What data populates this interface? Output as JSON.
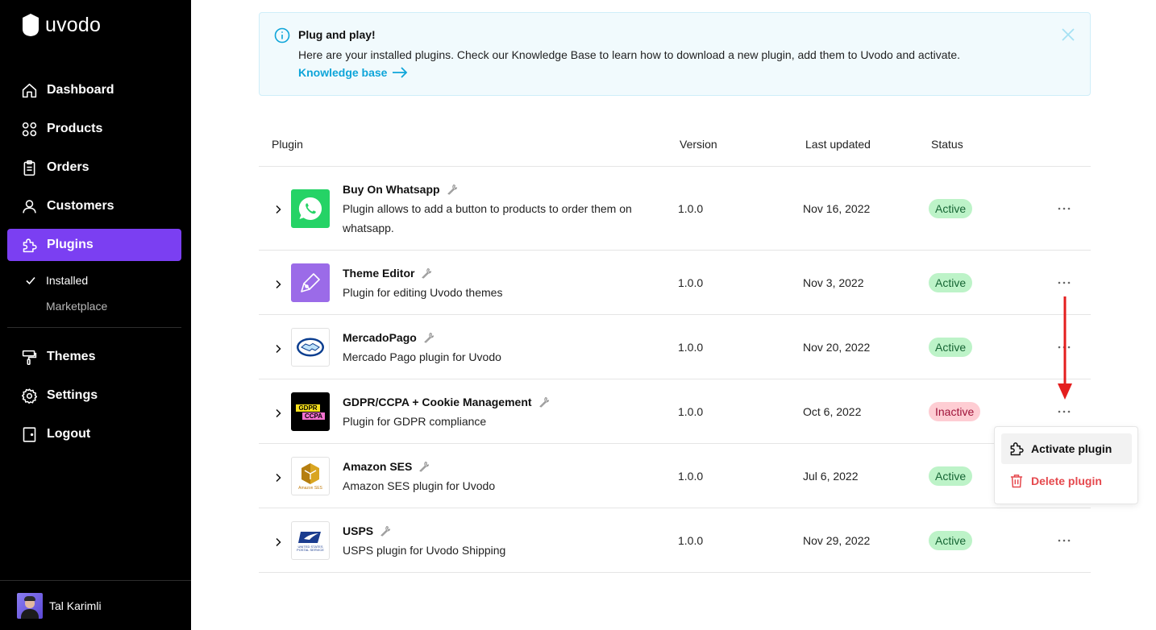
{
  "brand": {
    "name": "uvodo"
  },
  "sidebar": {
    "items": [
      {
        "label": "Dashboard",
        "icon": "home-icon"
      },
      {
        "label": "Products",
        "icon": "grid-icon"
      },
      {
        "label": "Orders",
        "icon": "clipboard-icon"
      },
      {
        "label": "Customers",
        "icon": "user-icon"
      },
      {
        "label": "Plugins",
        "icon": "puzzle-icon",
        "active": true
      }
    ],
    "subitems": [
      {
        "label": "Installed",
        "selected": true
      },
      {
        "label": "Marketplace"
      }
    ],
    "items_bottom": [
      {
        "label": "Themes",
        "icon": "paint-roller-icon"
      },
      {
        "label": "Settings",
        "icon": "gear-icon"
      },
      {
        "label": "Logout",
        "icon": "door-icon"
      }
    ],
    "user": {
      "name": "Tal Karimli"
    }
  },
  "banner": {
    "title": "Plug and play!",
    "text": "Here are your installed plugins. Check our Knowledge Base to learn how to download a new plugin, add them to Uvodo and activate.",
    "link": "Knowledge base"
  },
  "table": {
    "headers": {
      "plugin": "Plugin",
      "version": "Version",
      "updated": "Last updated",
      "status": "Status"
    },
    "rows": [
      {
        "name": "Buy On Whatsapp",
        "description": "Plugin allows to add a button to products to order them on whatsapp.",
        "version": "1.0.0",
        "updated": "Nov 16, 2022",
        "status": "Active",
        "logo": "whatsapp-logo"
      },
      {
        "name": "Theme Editor",
        "description": "Plugin for editing Uvodo themes",
        "version": "1.0.0",
        "updated": "Nov 3, 2022",
        "status": "Active",
        "logo": "theme-editor-logo"
      },
      {
        "name": "MercadoPago",
        "description": "Mercado Pago plugin for Uvodo",
        "version": "1.0.0",
        "updated": "Nov 20, 2022",
        "status": "Active",
        "logo": "mercadopago-logo"
      },
      {
        "name": "GDPR/CCPA + Cookie Management",
        "description": "Plugin for GDPR compliance",
        "version": "1.0.0",
        "updated": "Oct 6, 2022",
        "status": "Inactive",
        "logo": "gdpr-logo",
        "logo_text": [
          "GDPR",
          "CCPA"
        ]
      },
      {
        "name": "Amazon SES",
        "description": "Amazon SES plugin for Uvodo",
        "version": "1.0.0",
        "updated": "Jul 6, 2022",
        "status": "Active",
        "logo": "amazon-ses-logo",
        "logo_text": [
          "Amazon SES"
        ]
      },
      {
        "name": "USPS",
        "description": "USPS plugin for Uvodo Shipping",
        "version": "1.0.0",
        "updated": "Nov 29, 2022",
        "status": "Active",
        "logo": "usps-logo",
        "logo_text": [
          "UNITED STATES",
          "POSTAL SERVICE"
        ]
      }
    ]
  },
  "dropdown": {
    "activate": "Activate plugin",
    "delete": "Delete plugin"
  },
  "colors": {
    "accent": "#7b3ff2",
    "link": "#0ea5d9",
    "active_badge": "#bdf3c8",
    "inactive_badge": "#fecdd3",
    "danger": "#e5484d",
    "annotation_arrow": "#e41e1e"
  }
}
